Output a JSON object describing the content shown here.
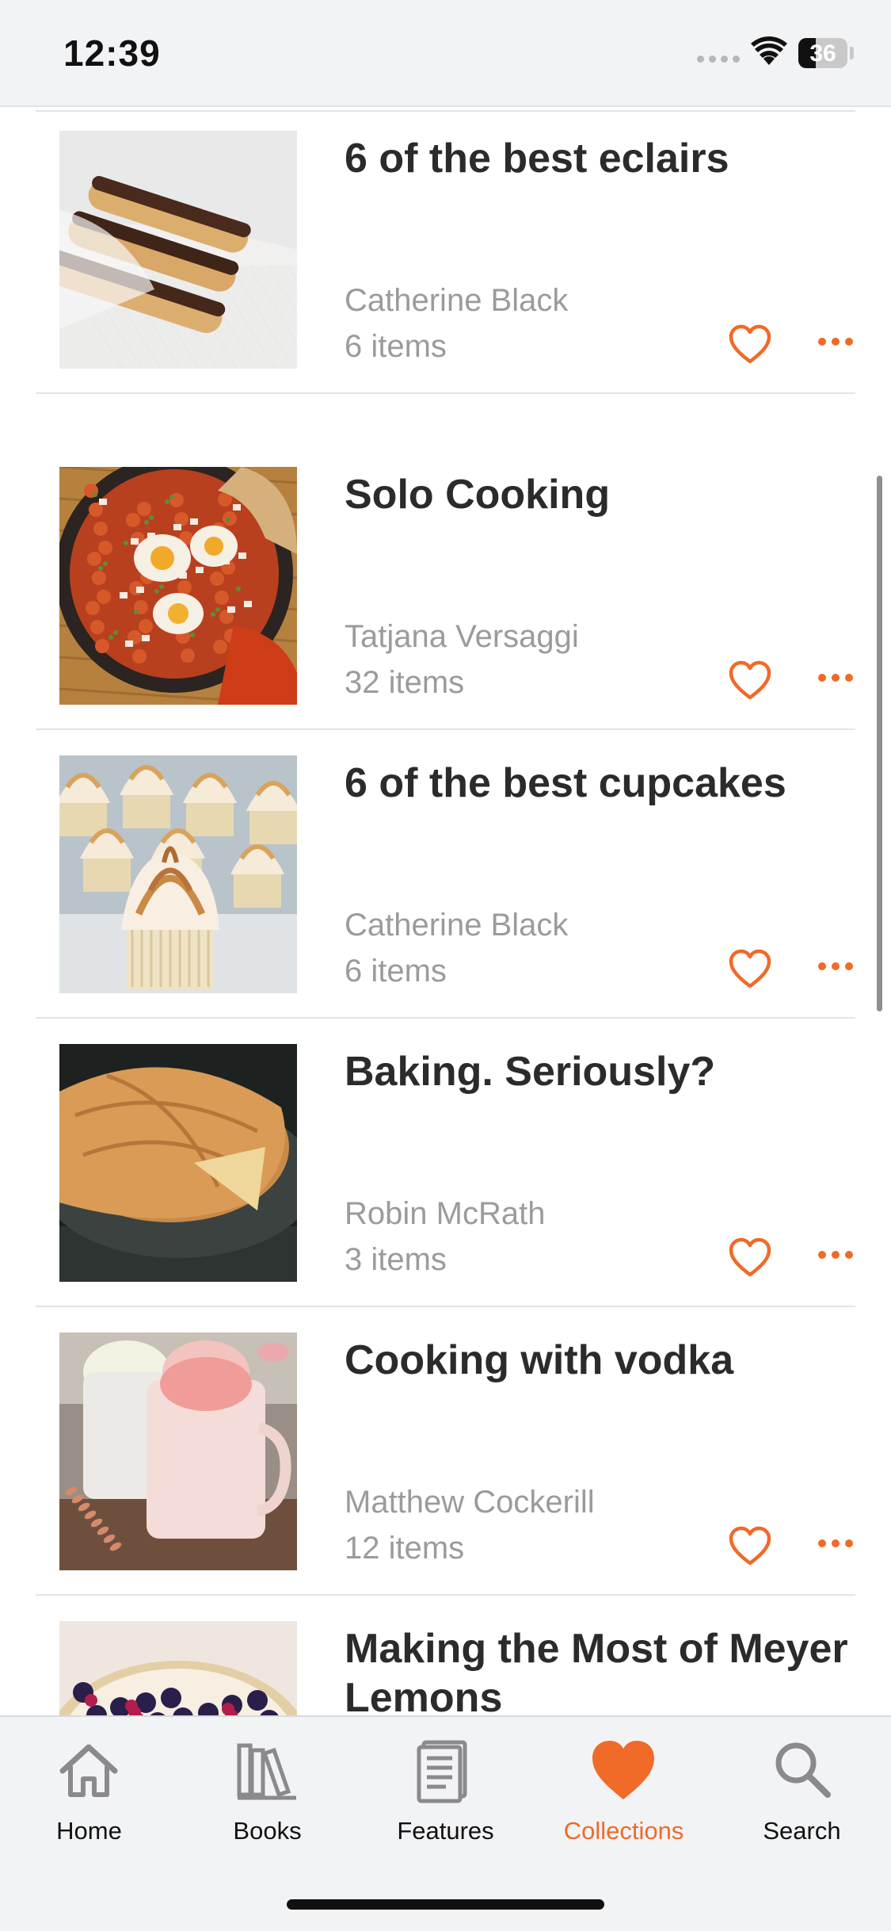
{
  "status_bar": {
    "time": "12:39",
    "battery": "36",
    "battery_level": 0.36
  },
  "collections": [
    {
      "title": "6 of the best eclairs",
      "author": "Catherine Black",
      "count": "6 items",
      "image": "eclairs"
    },
    {
      "title": "Solo Cooking",
      "author": "Tatjana Versaggi",
      "count": "32 items",
      "image": "shakshuka"
    },
    {
      "title": "6 of the best cupcakes",
      "author": "Catherine Black",
      "count": "6 items",
      "image": "meringue-cupcakes"
    },
    {
      "title": "Baking. Seriously?",
      "author": "Robin McRath",
      "count": "3 items",
      "image": "apple-pie"
    },
    {
      "title": "Cooking with vodka",
      "author": "Matthew Cockerill",
      "count": "12 items",
      "image": "sorbet-cups"
    },
    {
      "title": "Making the Most of Meyer Lemons",
      "author": "",
      "count": "",
      "image": "lemon-berry-tart"
    }
  ],
  "tabbar": {
    "tabs": [
      {
        "label": "Home",
        "icon": "home-icon"
      },
      {
        "label": "Books",
        "icon": "books-icon"
      },
      {
        "label": "Features",
        "icon": "features-icon"
      },
      {
        "label": "Collections",
        "icon": "heart-icon",
        "active": true
      },
      {
        "label": "Search",
        "icon": "search-icon"
      }
    ]
  },
  "colors": {
    "accent": "#f06a28",
    "title": "#2b2b2b",
    "meta": "#9b9b9b",
    "bar_bg": "#f2f3f5"
  }
}
